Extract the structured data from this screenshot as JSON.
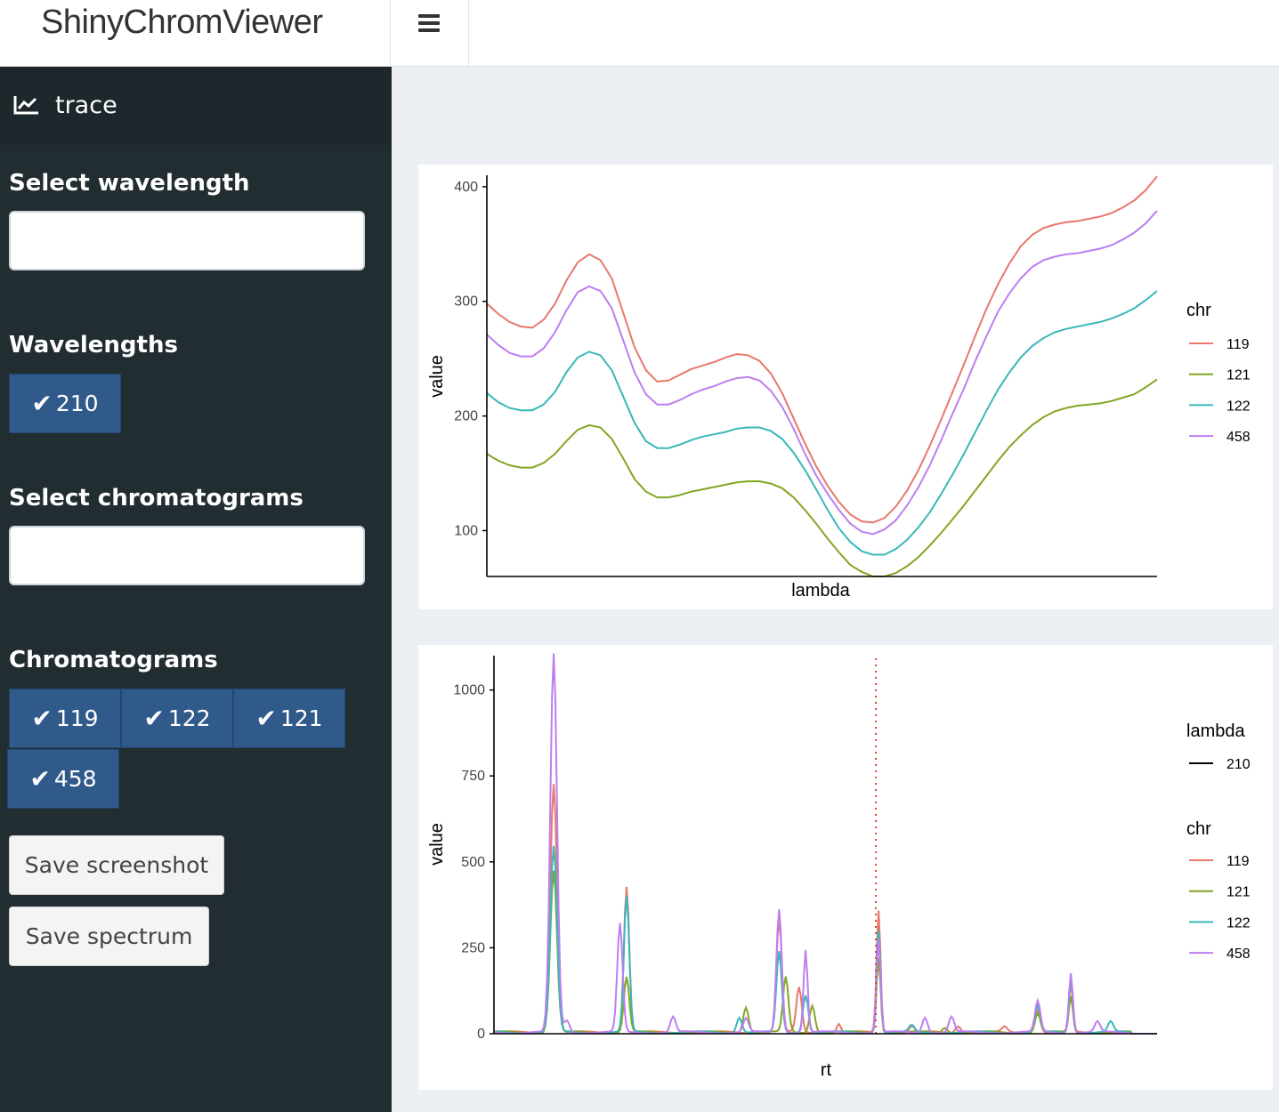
{
  "app": {
    "title": "ShinyChromViewer"
  },
  "sidebar": {
    "menu_item": {
      "label": "trace",
      "icon": "line-chart-icon"
    },
    "select_wavelength": {
      "label": "Select wavelength",
      "value": ""
    },
    "wavelengths": {
      "label": "Wavelengths",
      "chips": [
        "210"
      ]
    },
    "select_chromatograms": {
      "label": "Select chromatograms",
      "value": ""
    },
    "chromatograms": {
      "label": "Chromatograms",
      "chips": [
        "119",
        "122",
        "121",
        "458"
      ]
    },
    "buttons": {
      "save_screenshot": "Save screenshot",
      "save_spectrum": "Save spectrum"
    }
  },
  "colors": {
    "s119": "#e7786a",
    "s121": "#82a623",
    "s122": "#3ab7b9",
    "s458": "#bd7ef0",
    "vline": "#e0443a"
  },
  "spectrum_chart": {
    "xlabel": "lambda",
    "ylabel": "value",
    "yticks": [
      "100",
      "200",
      "300",
      "400"
    ],
    "legend_title": "chr",
    "legend": [
      "119",
      "121",
      "122",
      "458"
    ]
  },
  "trace_chart": {
    "xlabel": "rt",
    "ylabel": "value",
    "yticks": [
      "0",
      "250",
      "500",
      "750",
      "1000"
    ],
    "legend_lambda_title": "lambda",
    "legend_lambda": [
      "210"
    ],
    "legend_title": "chr",
    "legend": [
      "119",
      "121",
      "122",
      "458"
    ]
  },
  "chart_data": [
    {
      "type": "line",
      "xlabel": "lambda",
      "ylabel": "value",
      "ylim": [
        60,
        410
      ],
      "x": [
        0,
        1,
        2,
        3,
        4,
        5,
        6,
        7,
        8,
        9,
        10,
        11,
        12,
        13,
        14,
        15,
        16,
        17,
        18,
        19,
        20,
        21,
        22,
        23,
        24,
        25,
        26,
        27,
        28,
        29,
        30,
        31,
        32,
        33,
        34,
        35,
        36,
        37,
        38,
        39,
        40,
        41,
        42,
        43,
        44,
        45,
        46,
        47,
        48,
        49,
        50,
        51,
        52,
        53,
        54,
        55,
        56,
        57,
        58,
        59
      ],
      "legend_title": "chr",
      "series": [
        {
          "name": "119",
          "values": [
            298,
            289,
            282,
            278,
            277,
            284,
            298,
            318,
            334,
            341,
            336,
            320,
            290,
            260,
            240,
            230,
            231,
            236,
            241,
            244,
            247,
            251,
            254,
            253,
            248,
            237,
            220,
            198,
            176,
            156,
            139,
            125,
            114,
            108,
            107,
            111,
            121,
            135,
            153,
            174,
            197,
            221,
            245,
            270,
            294,
            315,
            333,
            348,
            358,
            364,
            367,
            369,
            370,
            372,
            374,
            377,
            382,
            388,
            397,
            409
          ]
        },
        {
          "name": "121",
          "values": [
            167,
            161,
            157,
            155,
            155,
            159,
            167,
            178,
            188,
            192,
            190,
            180,
            163,
            145,
            134,
            129,
            129,
            131,
            134,
            136,
            138,
            140,
            142,
            143,
            143,
            141,
            137,
            129,
            118,
            106,
            93,
            81,
            70,
            64,
            60,
            60,
            63,
            69,
            77,
            87,
            98,
            110,
            122,
            135,
            148,
            161,
            173,
            183,
            192,
            199,
            204,
            207,
            209,
            210,
            211,
            213,
            216,
            219,
            225,
            232
          ]
        },
        {
          "name": "122",
          "values": [
            220,
            212,
            207,
            205,
            205,
            210,
            221,
            238,
            251,
            256,
            253,
            240,
            217,
            194,
            178,
            172,
            172,
            175,
            179,
            182,
            184,
            186,
            189,
            190,
            190,
            187,
            180,
            168,
            153,
            136,
            118,
            102,
            90,
            82,
            79,
            79,
            84,
            92,
            103,
            116,
            132,
            149,
            167,
            186,
            205,
            223,
            238,
            251,
            261,
            268,
            273,
            276,
            278,
            280,
            282,
            285,
            289,
            294,
            301,
            309
          ]
        },
        {
          "name": "458",
          "values": [
            271,
            262,
            255,
            252,
            252,
            259,
            273,
            292,
            308,
            313,
            309,
            294,
            266,
            238,
            219,
            210,
            210,
            214,
            219,
            223,
            226,
            230,
            233,
            234,
            231,
            222,
            208,
            189,
            167,
            148,
            132,
            118,
            106,
            99,
            97,
            101,
            109,
            122,
            138,
            157,
            179,
            202,
            224,
            248,
            270,
            291,
            307,
            320,
            330,
            336,
            339,
            341,
            342,
            344,
            346,
            349,
            354,
            360,
            368,
            379
          ]
        }
      ]
    },
    {
      "type": "line",
      "xlabel": "rt",
      "ylabel": "value",
      "ylim": [
        0,
        1100
      ],
      "legend_title": "chr",
      "vline_color": "#e0443a",
      "series": [
        {
          "name": "119",
          "peaks": [
            [
              0.09,
              725,
              0.005
            ],
            [
              0.2,
              425,
              0.004
            ],
            [
              0.43,
              330,
              0.004
            ],
            [
              0.46,
              130,
              0.004
            ],
            [
              0.58,
              355,
              0.003
            ],
            [
              0.52,
              25,
              0.003
            ],
            [
              0.82,
              65,
              0.004
            ],
            [
              0.87,
              140,
              0.003
            ],
            [
              0.63,
              18,
              0.004
            ],
            [
              0.7,
              20,
              0.004
            ],
            [
              0.77,
              15,
              0.004
            ]
          ]
        },
        {
          "name": "121",
          "peaks": [
            [
              0.09,
              470,
              0.005
            ],
            [
              0.2,
              160,
              0.004
            ],
            [
              0.38,
              75,
              0.004
            ],
            [
              0.44,
              160,
              0.004
            ],
            [
              0.48,
              80,
              0.004
            ],
            [
              0.58,
              220,
              0.003
            ],
            [
              0.68,
              15,
              0.004
            ],
            [
              0.82,
              55,
              0.004
            ],
            [
              0.87,
              105,
              0.003
            ]
          ]
        },
        {
          "name": "122",
          "peaks": [
            [
              0.09,
              540,
              0.005
            ],
            [
              0.2,
              395,
              0.004
            ],
            [
              0.37,
              45,
              0.004
            ],
            [
              0.43,
              235,
              0.004
            ],
            [
              0.47,
              110,
              0.004
            ],
            [
              0.58,
              300,
              0.003
            ],
            [
              0.63,
              20,
              0.004
            ],
            [
              0.82,
              75,
              0.004
            ],
            [
              0.87,
              160,
              0.003
            ],
            [
              0.93,
              30,
              0.004
            ]
          ]
        },
        {
          "name": "458",
          "peaks": [
            [
              0.09,
              1100,
              0.005
            ],
            [
              0.11,
              35,
              0.004
            ],
            [
              0.19,
              315,
              0.004
            ],
            [
              0.27,
              45,
              0.004
            ],
            [
              0.38,
              40,
              0.004
            ],
            [
              0.43,
              360,
              0.004
            ],
            [
              0.47,
              240,
              0.003
            ],
            [
              0.58,
              270,
              0.003
            ],
            [
              0.65,
              45,
              0.004
            ],
            [
              0.69,
              45,
              0.004
            ],
            [
              0.82,
              90,
              0.004
            ],
            [
              0.87,
              175,
              0.003
            ],
            [
              0.91,
              30,
              0.004
            ]
          ]
        }
      ]
    }
  ]
}
